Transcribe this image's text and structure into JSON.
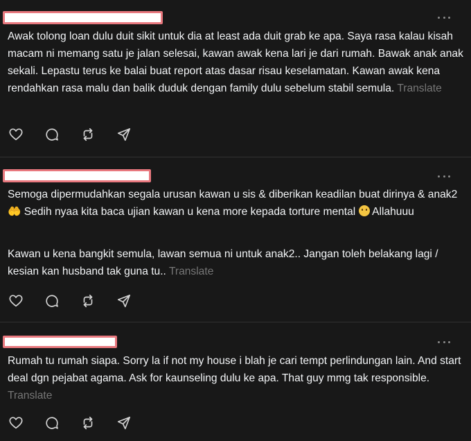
{
  "posts": [
    {
      "text": "Awak tolong loan dulu duit sikit untuk dia at least ada duit grab ke apa. Saya rasa kalau kisah macam ni memang satu je jalan selesai, kawan awak kena lari je dari rumah. Bawak anak anak sekali. Lepastu terus ke balai buat report atas dasar risau keselamatan. Kawan awak kena rendahkan rasa malu dan balik duduk dengan family dulu sebelum stabil semula.",
      "translate": "Translate"
    },
    {
      "text_p1": "Semoga dipermudahkan segala urusan kawan u sis & diberikan keadilan buat dirinya & anak2",
      "text_p1b": "Sedih nyaa kita baca ujian kawan u kena more kepada torture mental",
      "text_p1c": "Allahuuu",
      "emoji_hands": "🤲",
      "text_p2": "Kawan u kena bangkit semula, lawan semua ni untuk anak2.. Jangan toleh belakang lagi / kesian kan husband tak guna tu..",
      "translate": "Translate"
    },
    {
      "text": "Rumah tu rumah siapa. Sorry la if not my house i blah je cari tempt perlindungan lain. And start deal dgn pejabat agama. Ask for kaunseling dulu ke apa. That guy mmg tak responsible.",
      "translate": "Translate"
    }
  ],
  "icons": [
    "like-icon",
    "reply-icon",
    "repost-icon",
    "share-icon",
    "more-icon"
  ],
  "colors": {
    "background": "#181818",
    "text": "#f3f5f7",
    "muted": "#777777",
    "redaction_border": "#e8787e"
  }
}
